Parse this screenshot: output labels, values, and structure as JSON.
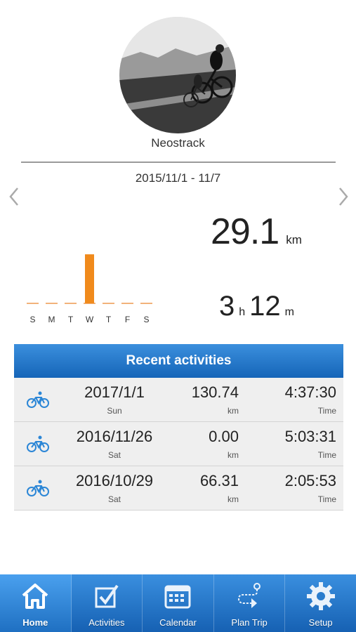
{
  "profile": {
    "username": "Neostrack"
  },
  "week": {
    "range": "2015/11/1 - 11/7"
  },
  "summary": {
    "distance_value": "29.1",
    "distance_unit": "km",
    "hours": "3",
    "hours_unit": "h",
    "minutes": "12",
    "minutes_unit": "m"
  },
  "chart_data": {
    "type": "bar",
    "categories": [
      "S",
      "M",
      "T",
      "W",
      "T",
      "F",
      "S"
    ],
    "values": [
      0,
      0,
      0,
      29.1,
      0,
      0,
      0
    ],
    "ylim": [
      0,
      30
    ],
    "xlabel": "",
    "ylabel": "",
    "bar_color": "#f08a1c"
  },
  "recent": {
    "title": "Recent activities",
    "rows": [
      {
        "date": "2017/1/1",
        "day": "Sun",
        "distance": "130.74",
        "distance_label": "km",
        "time": "4:37:30",
        "time_label": "Time"
      },
      {
        "date": "2016/11/26",
        "day": "Sat",
        "distance": "0.00",
        "distance_label": "km",
        "time": "5:03:31",
        "time_label": "Time"
      },
      {
        "date": "2016/10/29",
        "day": "Sat",
        "distance": "66.31",
        "distance_label": "km",
        "time": "2:05:53",
        "time_label": "Time"
      }
    ]
  },
  "tabs": [
    {
      "label": "Home",
      "icon": "home-icon",
      "active": true
    },
    {
      "label": "Activities",
      "icon": "checkbox-icon",
      "active": false
    },
    {
      "label": "Calendar",
      "icon": "calendar-icon",
      "active": false
    },
    {
      "label": "Plan Trip",
      "icon": "route-icon",
      "active": false
    },
    {
      "label": "Setup",
      "icon": "gear-icon",
      "active": false
    }
  ],
  "colors": {
    "accent": "#1f72c8",
    "bar": "#f08a1c",
    "bike_icon": "#2b86d6"
  }
}
